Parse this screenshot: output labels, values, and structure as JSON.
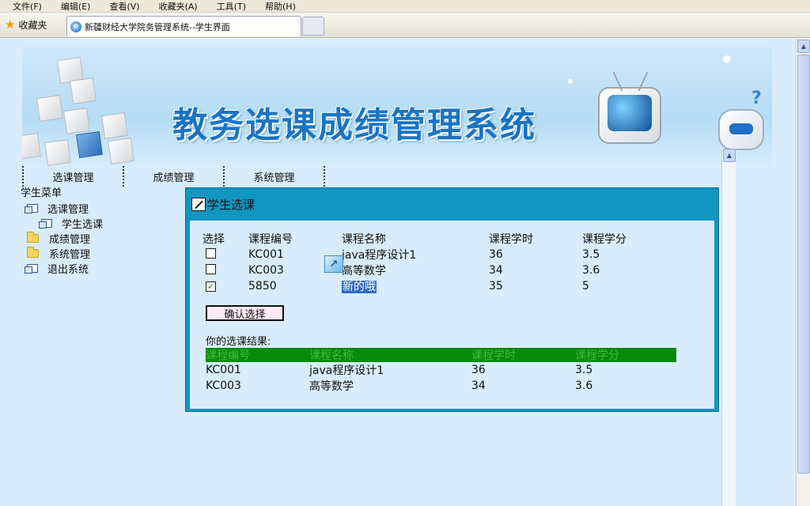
{
  "browser": {
    "menu": [
      "文件(F)",
      "编辑(E)",
      "查看(V)",
      "收藏夹(A)",
      "工具(T)",
      "帮助(H)"
    ],
    "favorites_label": "收藏夹",
    "tab_title": "新疆财经大学院务管理系统--学生界面"
  },
  "banner": {
    "title": "教务选课成绩管理系统"
  },
  "nav": {
    "items": [
      "选课管理",
      "成绩管理",
      "系统管理"
    ]
  },
  "sidebar": {
    "title": "学生菜单",
    "items": [
      {
        "label": "选课管理",
        "icon": "window-icon"
      },
      {
        "label": "学生选课",
        "icon": "window-icon"
      },
      {
        "label": "成绩管理",
        "icon": "folder-icon"
      },
      {
        "label": "系统管理",
        "icon": "folder-icon"
      },
      {
        "label": "退出系统",
        "icon": "window-icon"
      }
    ]
  },
  "panel": {
    "title": "学生选课",
    "columns": [
      "选择",
      "课程编号",
      "课程名称",
      "课程学时",
      "课程学分"
    ],
    "courses": [
      {
        "checked": false,
        "code": "KC001",
        "name": "java程序设计1",
        "hours": "36",
        "credits": "3.5"
      },
      {
        "checked": false,
        "code": "KC003",
        "name": "高等数学",
        "hours": "34",
        "credits": "3.6"
      },
      {
        "checked": true,
        "code": "5850",
        "name": "新的哦",
        "hours": "35",
        "credits": "5"
      }
    ],
    "confirm_label": "确认选择",
    "result_label": "你的选课结果:",
    "result_columns": [
      "课程编号",
      "课程名称",
      "课程学时",
      "课程学分"
    ],
    "results": [
      {
        "code": "KC001",
        "name": "java程序设计1",
        "hours": "36",
        "credits": "3.5"
      },
      {
        "code": "KC003",
        "name": "高等数学",
        "hours": "34",
        "credits": "3.6"
      }
    ]
  },
  "colors": {
    "panel_border": "#1196c0",
    "result_header_bg": "#0a8a0a",
    "page_bg": "#d8ecfb",
    "title_blue": "#1a74c2"
  }
}
